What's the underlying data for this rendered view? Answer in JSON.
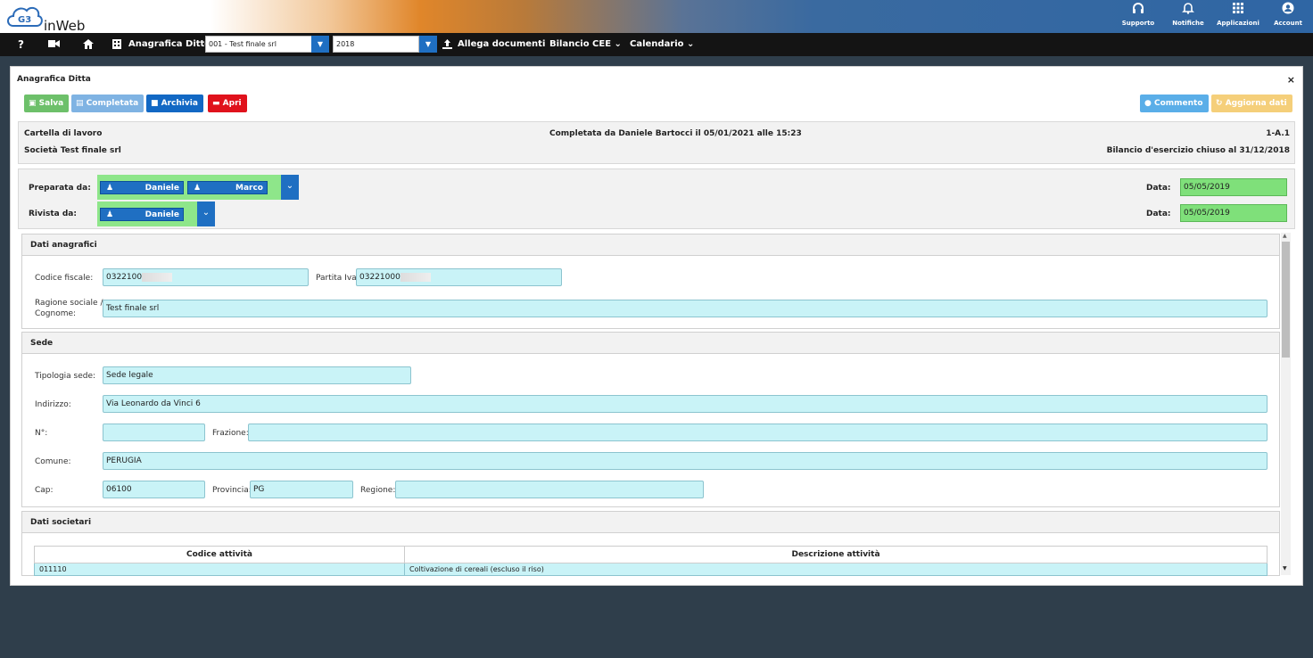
{
  "app": {
    "logo_text": "inWeb",
    "logo_mark": "G3"
  },
  "topright": [
    {
      "icon": "headset-icon",
      "glyph": "🎧",
      "label": "Supporto"
    },
    {
      "icon": "bell-icon",
      "glyph": "🔔",
      "label": "Notifiche"
    },
    {
      "icon": "grid-icon",
      "glyph": "▦",
      "label": "Applicazioni"
    },
    {
      "icon": "account-icon",
      "glyph": "●",
      "label": "Account"
    }
  ],
  "menubar": {
    "help": "?",
    "anagrafica_label": "Anagrafica Ditte",
    "company_select": "001 - Test finale srl",
    "year_select": "2018",
    "allega": "Allega documenti",
    "bilancio": "Bilancio CEE",
    "calendario": "Calendario"
  },
  "dialog": {
    "title": "Anagrafica Ditta",
    "close": "×",
    "buttons": {
      "salva": "Salva",
      "completata": "Completata",
      "archivia": "Archivia",
      "apri": "Apri",
      "commento": "Commento",
      "aggiorna": "Aggiorna dati"
    },
    "info": {
      "cartella": "Cartella di lavoro",
      "completata_da": "Completata da Daniele Bartocci il 05/01/2021 alle 15:23",
      "code": "1-A.1",
      "societa": "Società Test finale srl",
      "bilancio": "Bilancio d'esercizio chiuso al 31/12/2018"
    },
    "review": {
      "preparata_label": "Preparata da:",
      "preparata_users": [
        "Daniele",
        "Marco"
      ],
      "rivista_label": "Rivista da:",
      "rivista_users": [
        "Daniele"
      ],
      "data_label": "Data:",
      "data_preparata": "05/05/2019",
      "data_rivista": "05/05/2019"
    }
  },
  "dati_anagrafici": {
    "title": "Dati anagrafici",
    "codice_fiscale_label": "Codice fiscale:",
    "codice_fiscale": "0322100",
    "partita_iva_label": "Partita Iva:",
    "partita_iva": "03221000",
    "ragione_sociale_label_1": "Ragione sociale /",
    "ragione_sociale_label_2": "Cognome:",
    "ragione_sociale": "Test finale srl"
  },
  "sede": {
    "title": "Sede",
    "tipologia_label": "Tipologia sede:",
    "tipologia": "Sede legale",
    "indirizzo_label": "Indirizzo:",
    "indirizzo": "Via Leonardo da Vinci 6",
    "numero_label": "N°:",
    "numero": "",
    "frazione_label": "Frazione:",
    "frazione": "",
    "comune_label": "Comune:",
    "comune": "PERUGIA",
    "cap_label": "Cap:",
    "cap": "06100",
    "provincia_label": "Provincia:",
    "provincia": "PG",
    "regione_label": "Regione:",
    "regione": ""
  },
  "dati_societari": {
    "title": "Dati societari",
    "columns": [
      "Codice attività",
      "Descrizione attività"
    ],
    "rows": [
      [
        "011110",
        "Coltivazione di cereali (escluso il riso)"
      ]
    ]
  }
}
